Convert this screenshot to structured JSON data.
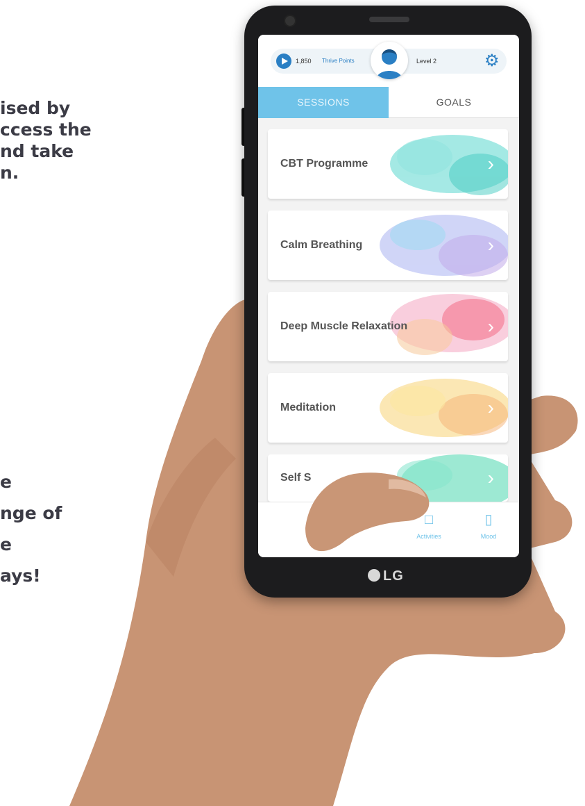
{
  "promo": {
    "top_lines": [
      "ised by",
      "ccess the",
      "nd take",
      "n."
    ],
    "bottom_lines": [
      "e",
      "nge of",
      "e",
      "",
      "ays!"
    ]
  },
  "device": {
    "brand": "LG"
  },
  "header": {
    "points_value": "1,850",
    "points_label": "Thrive Points",
    "level": "Level 2",
    "icons": [
      "play-icon",
      "avatar",
      "gear-icon"
    ]
  },
  "tabs": [
    {
      "label": "SESSIONS",
      "active": true
    },
    {
      "label": "GOALS",
      "active": false
    }
  ],
  "sessions": [
    {
      "label": "CBT Programme",
      "color": "#3ecfc6"
    },
    {
      "label": "Calm Breathing",
      "color": "#9aa6ee"
    },
    {
      "label": "Deep Muscle Relaxation",
      "color": "#f07a9a"
    },
    {
      "label": "Meditation",
      "color": "#f6cf6a"
    },
    {
      "label": "Self S",
      "color": "#3fd3a8"
    }
  ],
  "bottom_nav": [
    {
      "label": "",
      "icon": ""
    },
    {
      "label": "",
      "icon": ""
    },
    {
      "label": "Activities",
      "icon": "chat-icon"
    },
    {
      "label": "Mood",
      "icon": "thermometer-icon"
    }
  ],
  "colors": {
    "accent": "#6fc3e9",
    "brand_blue": "#2a7fc4",
    "promo_text": "#3b3b45"
  }
}
